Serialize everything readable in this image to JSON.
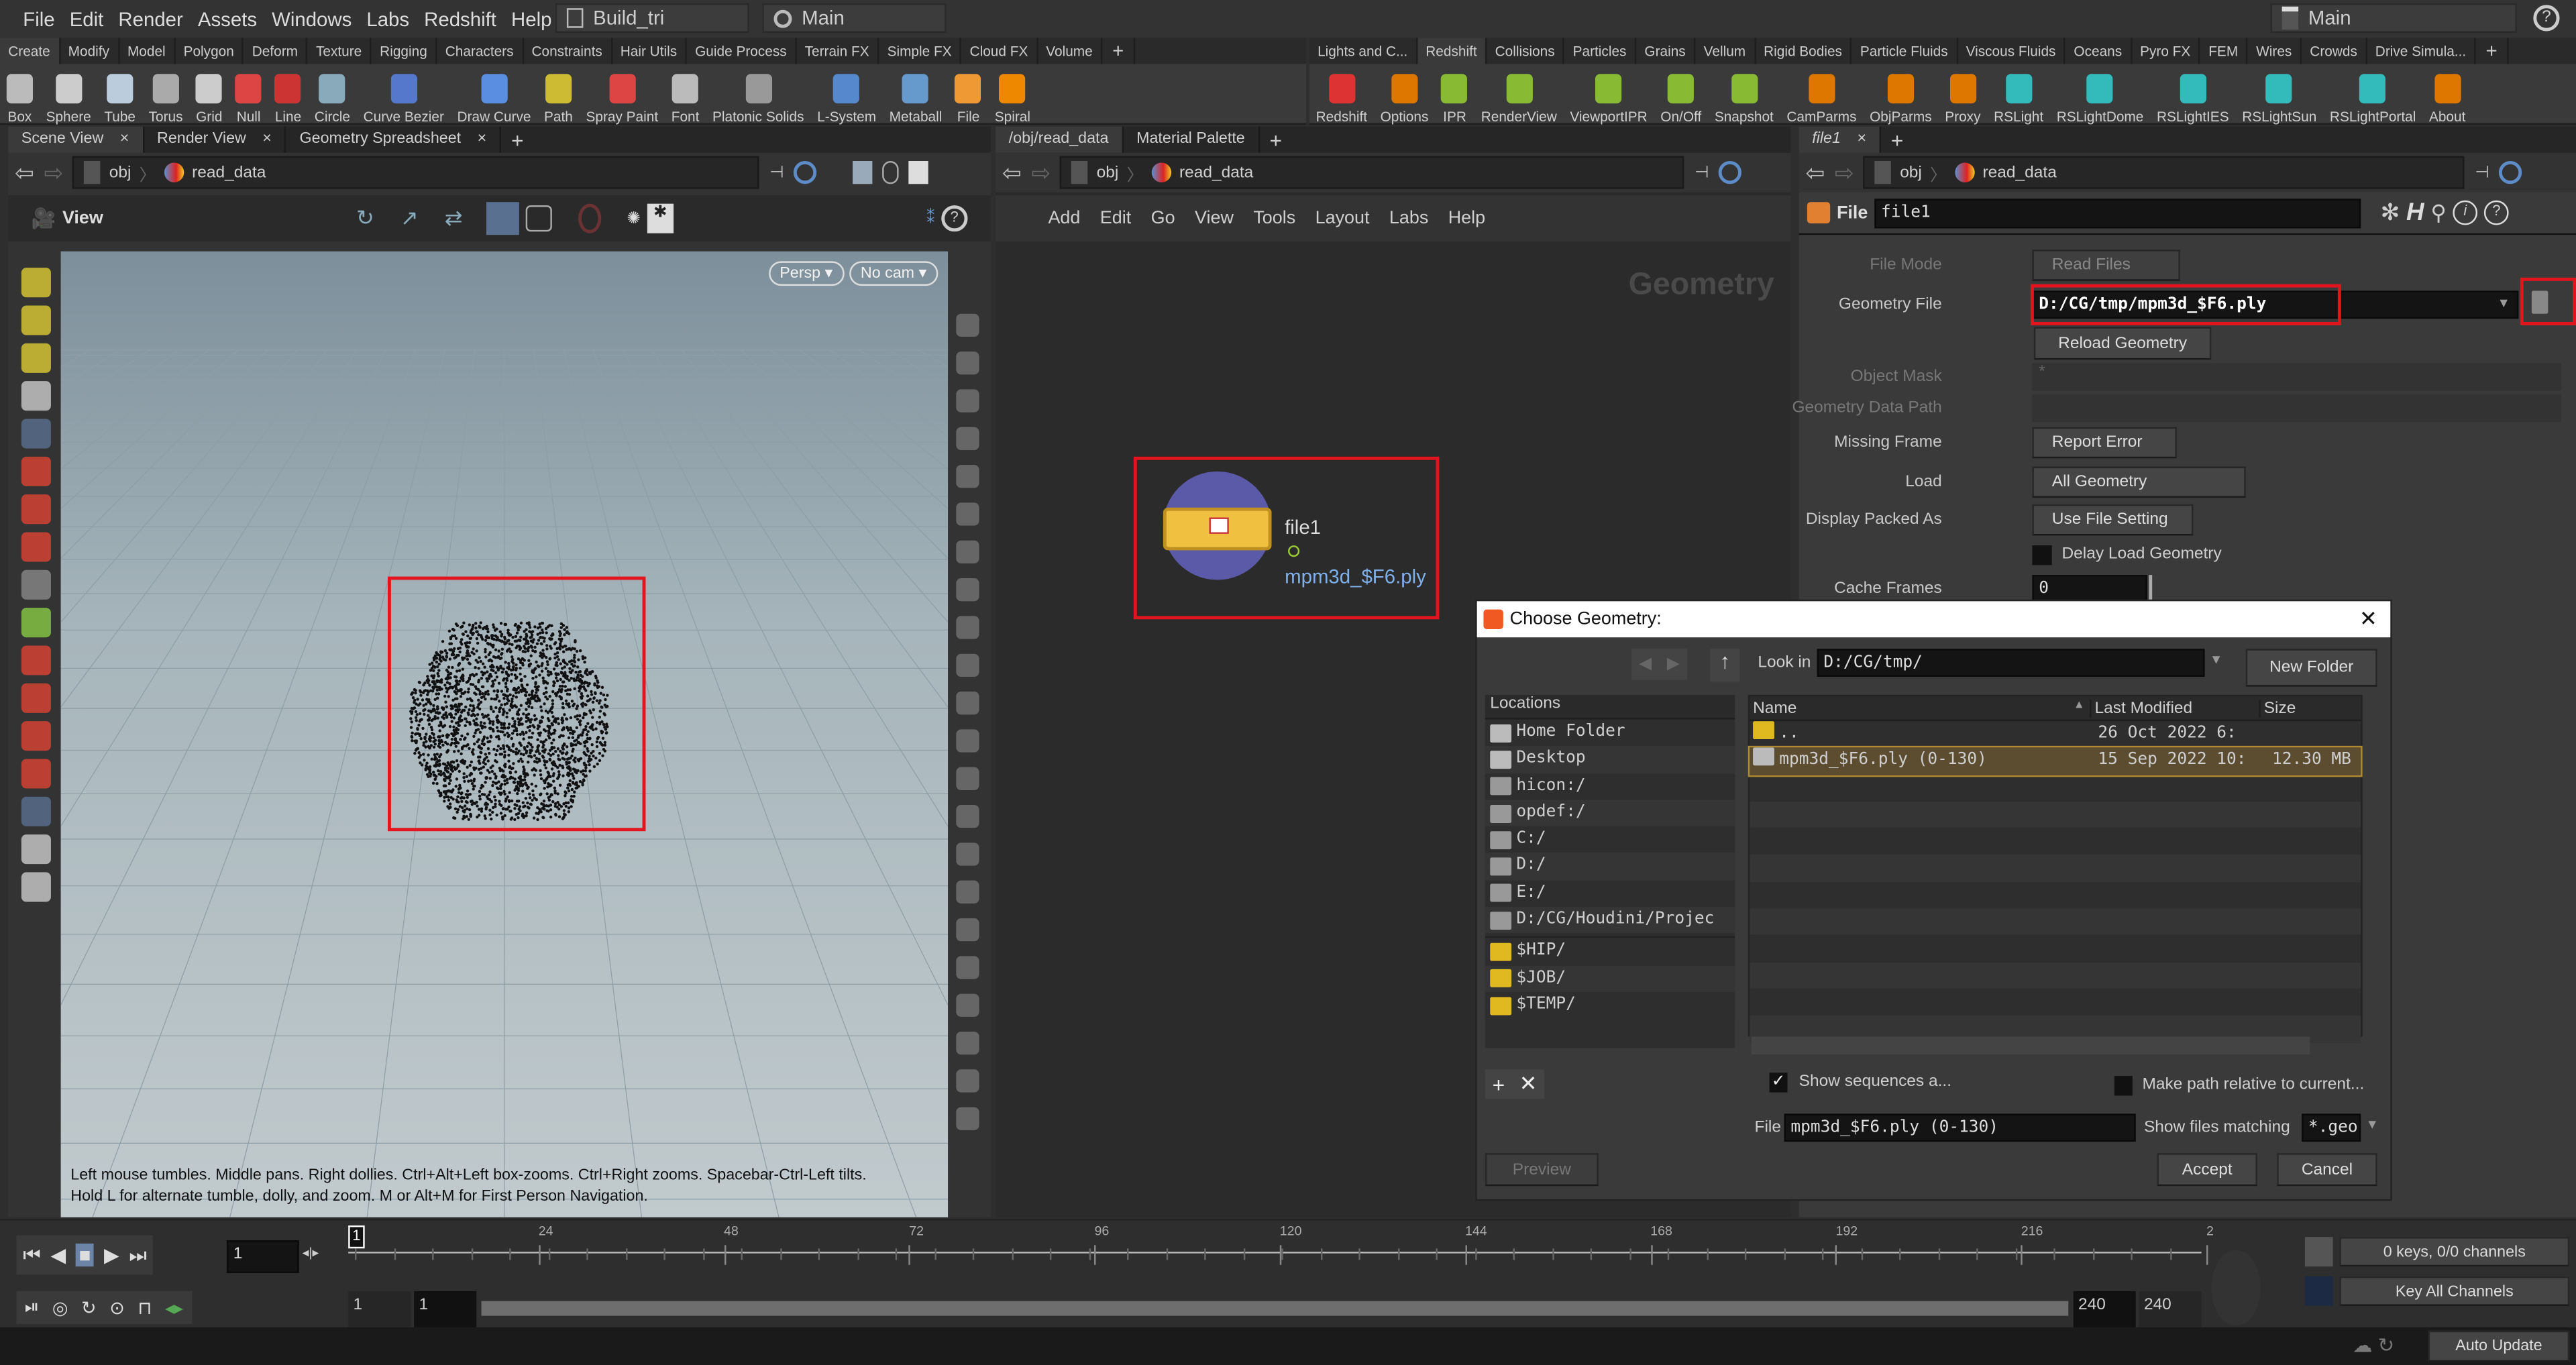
{
  "menu": [
    "File",
    "Edit",
    "Render",
    "Assets",
    "Windows",
    "Labs",
    "Redshift",
    "Help"
  ],
  "desktop": "Build_tri",
  "context": "Main",
  "take": "Main",
  "shelf_left": {
    "tabs": [
      "Create",
      "Modify",
      "Model",
      "Polygon",
      "Deform",
      "Texture",
      "Rigging",
      "Characters",
      "Constraints",
      "Hair Utils",
      "Guide Process",
      "Terrain FX",
      "Simple FX",
      "Cloud FX",
      "Volume"
    ],
    "tools": [
      "Box",
      "Sphere",
      "Tube",
      "Torus",
      "Grid",
      "Null",
      "Line",
      "Circle",
      "Curve Bezier",
      "Draw Curve",
      "Path",
      "Spray Paint",
      "Font",
      "Platonic Solids",
      "L-System",
      "Metaball",
      "File",
      "Spiral"
    ]
  },
  "shelf_right": {
    "tabs": [
      "Lights and C...",
      "Redshift",
      "Collisions",
      "Particles",
      "Grains",
      "Vellum",
      "Rigid Bodies",
      "Particle Fluids",
      "Viscous Fluids",
      "Oceans",
      "Pyro FX",
      "FEM",
      "Wires",
      "Crowds",
      "Drive Simula..."
    ],
    "tools": [
      "Redshift",
      "Options",
      "IPR",
      "RenderView",
      "ViewportIPR",
      "On/Off",
      "Snapshot",
      "CamParms",
      "ObjParms",
      "Proxy",
      "RSLight",
      "RSLightDome",
      "RSLightIES",
      "RSLightSun",
      "RSLightPortal",
      "About"
    ]
  },
  "scene": {
    "tabs": [
      "Scene View",
      "Render View",
      "Geometry Spreadsheet"
    ],
    "path": [
      "obj",
      "read_data"
    ],
    "view_label": "View",
    "persp": "Persp",
    "cam": "No cam",
    "hint1": "Left mouse tumbles. Middle pans. Right dollies. Ctrl+Alt+Left box-zooms. Ctrl+Right zooms. Spacebar-Ctrl-Left tilts.",
    "hint2": "Hold L for alternate tumble, dolly, and zoom.     M or Alt+M for First Person Navigation."
  },
  "network": {
    "tabs": [
      "/obj/read_data",
      "Material Palette"
    ],
    "path": [
      "obj",
      "read_data"
    ],
    "menu": [
      "Add",
      "Edit",
      "Go",
      "View",
      "Tools",
      "Layout",
      "Labs",
      "Help"
    ],
    "context_label": "Geometry",
    "node": {
      "name": "file1",
      "file": "mpm3d_$F6.ply"
    }
  },
  "params": {
    "tab": "file1",
    "path": [
      "obj",
      "read_data"
    ],
    "type": "File",
    "name": "file1",
    "file_mode": {
      "label": "File Mode",
      "value": "Read Files"
    },
    "geometry_file": {
      "label": "Geometry File",
      "value": "D:/CG/tmp/mpm3d_$F6.ply"
    },
    "reload": "Reload Geometry",
    "object_mask": {
      "label": "Object Mask",
      "value": "*"
    },
    "data_path": {
      "label": "Geometry Data Path",
      "value": ""
    },
    "missing_frame": {
      "label": "Missing Frame",
      "value": "Report Error"
    },
    "load": {
      "label": "Load",
      "value": "All Geometry"
    },
    "display_packed": {
      "label": "Display Packed As",
      "value": "Use File Setting"
    },
    "delay_load": {
      "label": "Delay Load Geometry",
      "checked": false
    },
    "cache_frames": {
      "label": "Cache Frames",
      "value": "0"
    }
  },
  "dialog": {
    "title": "Choose Geometry:",
    "look_in_label": "Look in",
    "look_in": "D:/CG/tmp/",
    "new_folder": "New Folder",
    "locations_header": "Locations",
    "locations": [
      "Home Folder",
      "Desktop",
      "hicon:/",
      "opdef:/",
      "C:/",
      "D:/",
      "E:/",
      "D:/CG/Houdini/Projec"
    ],
    "vars": [
      "$HIP/",
      "$JOB/",
      "$TEMP/"
    ],
    "columns": [
      "Name",
      "Last Modified",
      "Size"
    ],
    "files": [
      {
        "name": "..",
        "modified": "26 Oct 2022  6:",
        "size": ""
      },
      {
        "name": "mpm3d_$F6.ply (0-130)",
        "modified": "15 Sep 2022 10:",
        "size": "12.30 MB"
      }
    ],
    "show_sequences": {
      "label": "Show sequences a...",
      "checked": true
    },
    "relative": {
      "label": "Make path relative to current...",
      "checked": false
    },
    "file_label": "File",
    "file_value": "mpm3d_$F6.ply (0-130)",
    "filter_label": "Show files matching",
    "filter_value": "*.geo",
    "preview": "Preview",
    "accept": "Accept",
    "cancel": "Cancel"
  },
  "timeline": {
    "frame": "1",
    "current_marker": "1",
    "ticks": [
      "24",
      "48",
      "72",
      "96",
      "120",
      "144",
      "168",
      "192",
      "216",
      "2"
    ],
    "range_start": "1",
    "range_start2": "1",
    "range_end": "240",
    "range_end2": "240",
    "keys": "0 keys, 0/0 channels",
    "key_all": "Key All Channels",
    "auto_update": "Auto Update"
  },
  "colors": {
    "highlight": "#e3141e",
    "selection": "#5c4d30",
    "link": "#7fb0ea"
  }
}
